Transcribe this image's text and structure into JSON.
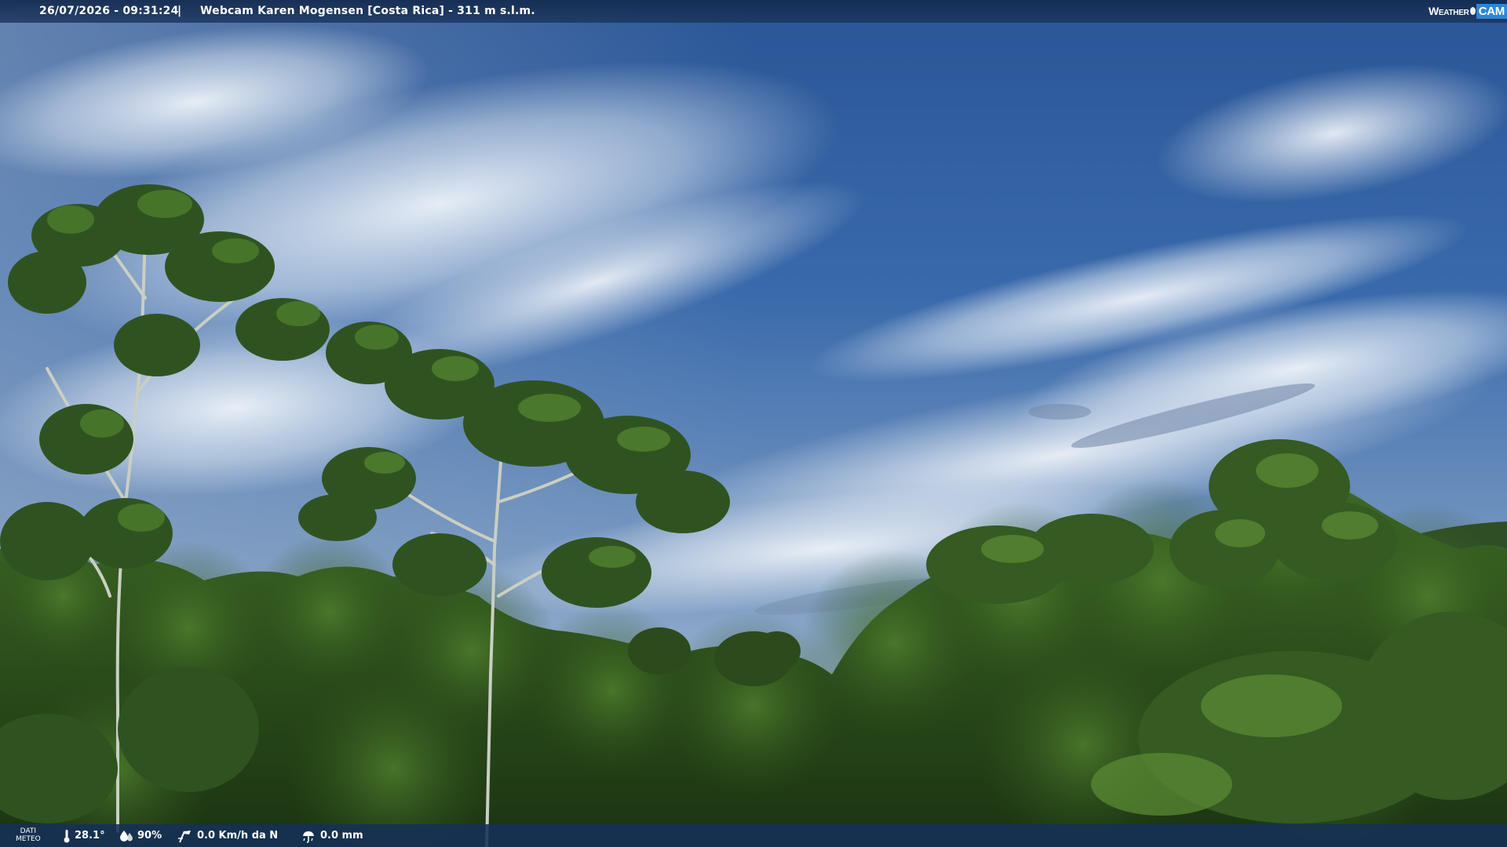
{
  "top_bar": {
    "timestamp": "26/07/2026 - 09:31:24",
    "separator": "|",
    "title": "Webcam Karen Mogensen [Costa Rica] - 311 m s.l.m."
  },
  "logo": {
    "weather": "Weather",
    "cam": "CAM"
  },
  "bottom_bar": {
    "dati_label_line1": "DATI",
    "dati_label_line2": "METEO",
    "temperature": "28.1°",
    "humidity": "90%",
    "wind": "0.0 Km/h da N",
    "rain": "0.0 mm"
  },
  "colors": {
    "sky_top": "#2f5d9e",
    "sky_horizon": "#c9d6e6",
    "foliage_dark": "#1f3a17",
    "foliage_light": "#4e7a2c",
    "bar_bg": "#163058",
    "logo_accent": "#2e86d6"
  },
  "icons": {
    "temperature": "thermometer-icon",
    "humidity": "humidity-drop-icon",
    "wind": "wind-icon",
    "rain": "rain-gauge-icon"
  }
}
